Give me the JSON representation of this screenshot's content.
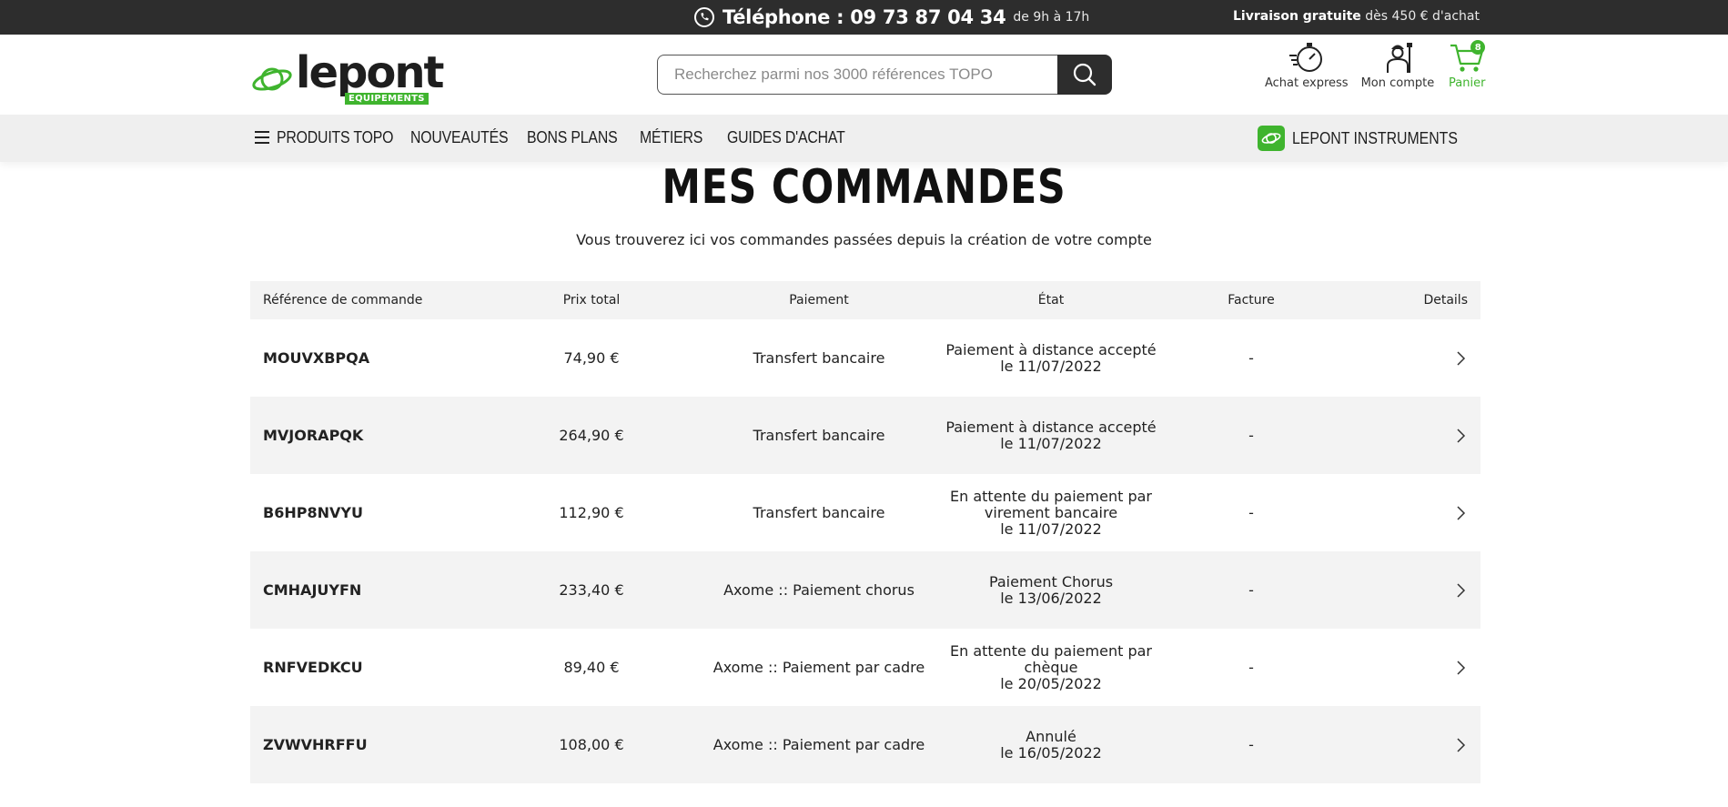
{
  "topbar": {
    "phone_label": "Téléphone : 09 73 87 04 34",
    "hours": "de 9h à 17h",
    "delivery_bold": "Livraison gratuite",
    "delivery_rest": " dès 450 € d'achat"
  },
  "logo": {
    "name": "lepont",
    "tagline": "EQUIPEMENTS"
  },
  "search": {
    "placeholder": "Recherchez parmi nos 3000 références TOPO"
  },
  "header_actions": {
    "express": "Achat express",
    "account": "Mon compte",
    "cart": "Panier",
    "cart_count": "8"
  },
  "nav": {
    "items": [
      "PRODUITS TOPO",
      "NOUVEAUTÉS",
      "BONS PLANS",
      "MÉTIERS",
      "GUIDES D'ACHAT"
    ],
    "instruments": "LEPONT INSTRUMENTS"
  },
  "page": {
    "title": "MES COMMANDES",
    "subtitle": "Vous trouverez ici vos commandes passées depuis la création de votre compte"
  },
  "table": {
    "headers": {
      "ref": "Référence de commande",
      "price": "Prix total",
      "payment": "Paiement",
      "state": "État",
      "invoice": "Facture",
      "details": "Details"
    },
    "rows": [
      {
        "ref": "MOUVXBPQA",
        "price": "74,90 €",
        "payment": "Transfert bancaire",
        "state": "Paiement à distance accepté",
        "date": "le 11/07/2022",
        "invoice": "-"
      },
      {
        "ref": "MVJORAPQK",
        "price": "264,90 €",
        "payment": "Transfert bancaire",
        "state": "Paiement à distance accepté",
        "date": "le 11/07/2022",
        "invoice": "-"
      },
      {
        "ref": "B6HP8NVYU",
        "price": "112,90 €",
        "payment": "Transfert bancaire",
        "state": "En attente du paiement par virement bancaire",
        "date": "le 11/07/2022",
        "invoice": "-"
      },
      {
        "ref": "CMHAJUYFN",
        "price": "233,40 €",
        "payment": "Axome :: Paiement chorus",
        "state": "Paiement Chorus",
        "date": "le 13/06/2022",
        "invoice": "-"
      },
      {
        "ref": "RNFVEDKCU",
        "price": "89,40 €",
        "payment": "Axome :: Paiement par cadre",
        "state": "En attente du paiement par chèque",
        "date": "le 20/05/2022",
        "invoice": "-"
      },
      {
        "ref": "ZVWVHRFFU",
        "price": "108,00 €",
        "payment": "Axome :: Paiement par cadre",
        "state": "Annulé",
        "date": "le 16/05/2022",
        "invoice": "-"
      }
    ]
  },
  "colors": {
    "brand_green": "#3fb42e",
    "dark": "#2d2d2d",
    "row_alt": "#f3f3f3"
  }
}
